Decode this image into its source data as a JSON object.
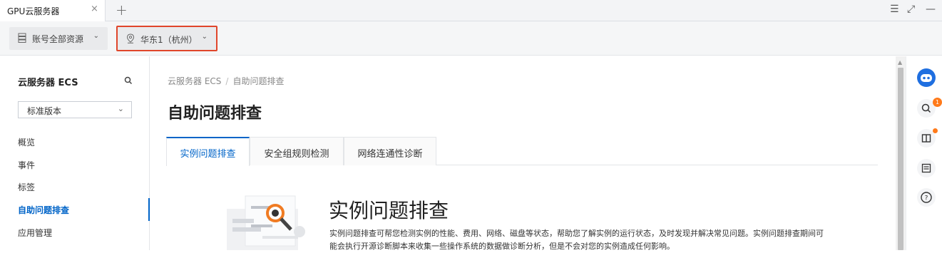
{
  "browser_tab": {
    "title": "GPU云服务器",
    "close_glyph": "×",
    "add_glyph": "+"
  },
  "window_controls": {
    "menu": "☰",
    "restore": "⤢",
    "minimize": "—"
  },
  "toolbar": {
    "account_selector": {
      "label": "账号全部资源",
      "icon": "server-stack-icon"
    },
    "region_selector": {
      "label": "华东1（杭州）",
      "icon": "location-pin-icon",
      "highlight_color": "#e0462b"
    }
  },
  "sidebar": {
    "title": "云服务器 ECS",
    "version_select": {
      "value": "标准版本"
    },
    "items": [
      {
        "label": "概览"
      },
      {
        "label": "事件"
      },
      {
        "label": "标签"
      },
      {
        "label": "自助问题排查",
        "active": true
      },
      {
        "label": "应用管理"
      }
    ]
  },
  "main": {
    "breadcrumb": [
      "云服务器 ECS",
      "自助问题排查"
    ],
    "breadcrumb_sep": "/",
    "title": "自助问题排查",
    "tabs": [
      {
        "label": "实例问题排查",
        "active": true
      },
      {
        "label": "安全组规则检测"
      },
      {
        "label": "网络连通性诊断"
      }
    ],
    "hero": {
      "title": "实例问题排查",
      "description": "实例问题排查可帮您检测实例的性能、费用、网络、磁盘等状态，帮助您了解实例的运行状态，及时发现并解决常见问题。实例问题排查期间可能会执行开源诊断脚本来收集一些操作系统的数据做诊断分析，但是不会对您的实例造成任何影响。"
    }
  },
  "right_rail": {
    "items": [
      "assistant-robot-icon",
      "search-icon",
      "book-icon",
      "checklist-icon",
      "help-icon"
    ],
    "search_badge": "1"
  },
  "colors": {
    "accent": "#0064c8",
    "badge": "#ff7a1a"
  }
}
